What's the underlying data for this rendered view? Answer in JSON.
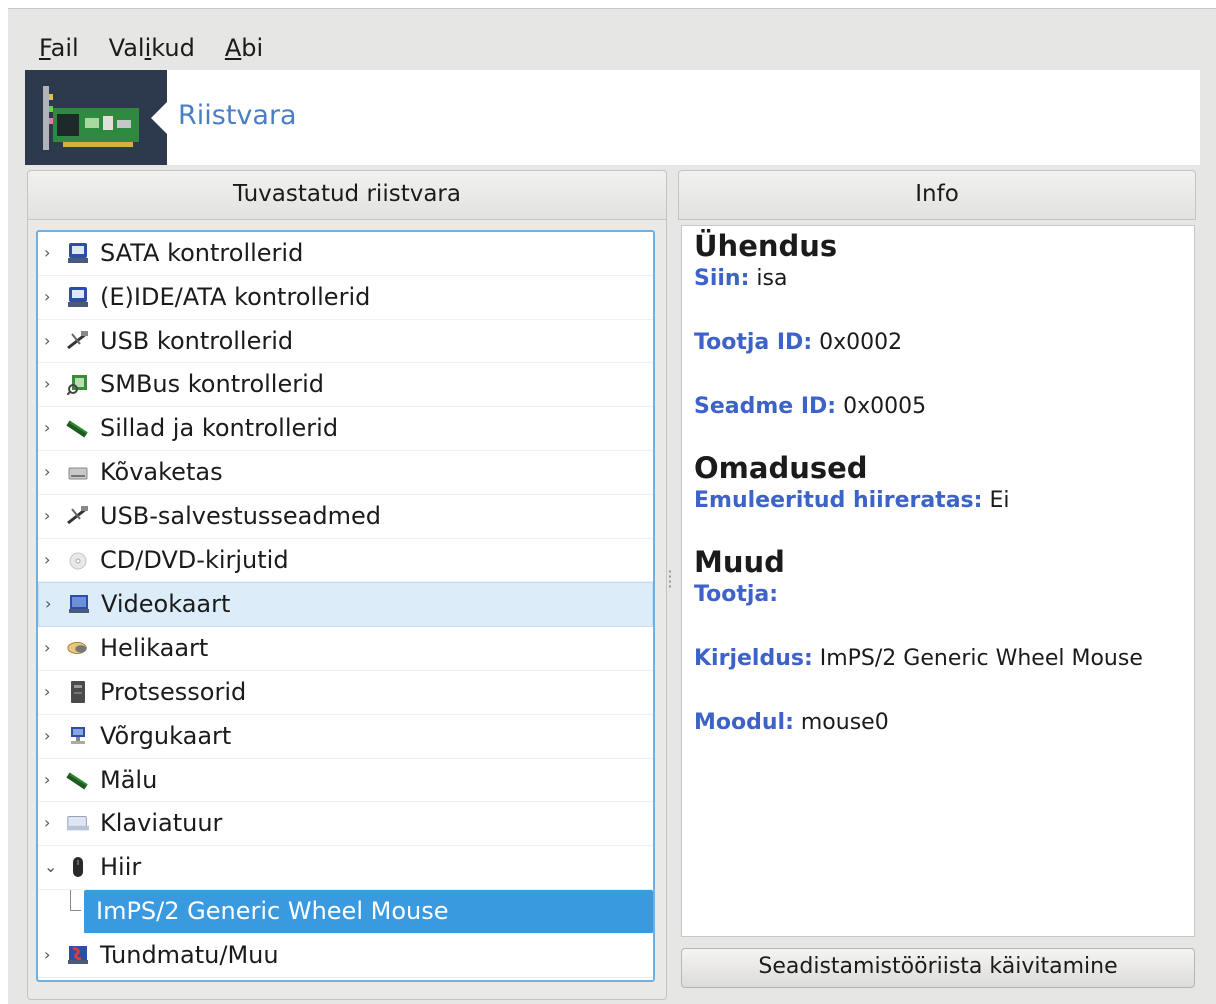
{
  "menubar": {
    "file": {
      "mnemonic": "F",
      "rest": "ail"
    },
    "options": {
      "pre": "Val",
      "mnemonic": "i",
      "rest": "kud"
    },
    "help": {
      "mnemonic": "A",
      "rest": "bi"
    }
  },
  "banner": {
    "title": "Riistvara",
    "icon": "sound-card-icon"
  },
  "left_panel": {
    "header": "Tuvastatud riistvara",
    "items": [
      {
        "label": "SATA kontrollerid",
        "icon": "disk-controller-icon",
        "expanded": false
      },
      {
        "label": "(E)IDE/ATA kontrollerid",
        "icon": "disk-controller-icon",
        "expanded": false
      },
      {
        "label": "USB kontrollerid",
        "icon": "usb-icon",
        "expanded": false
      },
      {
        "label": "SMBus kontrollerid",
        "icon": "smbus-icon",
        "expanded": false
      },
      {
        "label": "Sillad ja kontrollerid",
        "icon": "memory-stick-icon",
        "expanded": false
      },
      {
        "label": "Kõvaketas",
        "icon": "hard-disk-icon",
        "expanded": false
      },
      {
        "label": "USB-salvestusseadmed",
        "icon": "usb-icon",
        "expanded": false
      },
      {
        "label": "CD/DVD-kirjutid",
        "icon": "optical-disc-icon",
        "expanded": false
      },
      {
        "label": "Videokaart",
        "icon": "monitor-icon",
        "expanded": false
      },
      {
        "label": "Helikaart",
        "icon": "speaker-icon",
        "expanded": false
      },
      {
        "label": "Protsessorid",
        "icon": "cpu-icon",
        "expanded": false
      },
      {
        "label": "Võrgukaart",
        "icon": "network-icon",
        "expanded": false
      },
      {
        "label": "Mälu",
        "icon": "memory-stick-icon",
        "expanded": false
      },
      {
        "label": "Klaviatuur",
        "icon": "keyboard-icon",
        "expanded": false
      },
      {
        "label": "Hiir",
        "icon": "mouse-icon",
        "expanded": true
      },
      {
        "label": "ImPS/2 Generic Wheel Mouse",
        "child": true,
        "selected": true
      },
      {
        "label": "Tundmatu/Muu",
        "icon": "unknown-device-icon",
        "expanded": false
      }
    ]
  },
  "right_panel": {
    "header": "Info",
    "sections": {
      "connection_title": "Ühendus",
      "bus_key": "Siin:",
      "bus_val": " isa",
      "vendor_id_key": "Tootja ID:",
      "vendor_id_val": " 0x0002",
      "device_id_key": "Seadme ID:",
      "device_id_val": " 0x0005",
      "props_title": "Omadused",
      "emulated_key": "Emuleeritud hiireratas:",
      "emulated_val": " Ei",
      "misc_title": "Muud",
      "vendor_key": "Tootja:",
      "vendor_val": "",
      "desc_key": "Kirjeldus:",
      "desc_val": " ImPS/2 Generic Wheel Mouse",
      "module_key": "Moodul:",
      "module_val": " mouse0"
    },
    "configure_button": "Seadistamistööriista käivitamine"
  }
}
